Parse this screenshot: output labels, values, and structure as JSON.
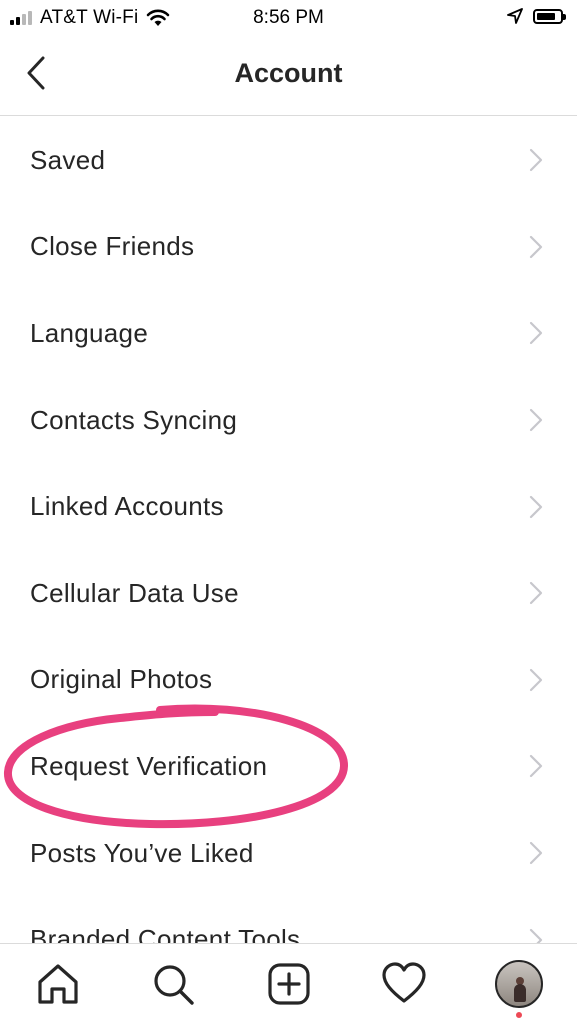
{
  "status_bar": {
    "carrier": "AT&T Wi-Fi",
    "time": "8:56 PM",
    "icons": [
      "signal-icon",
      "wifi-icon",
      "location-arrow-icon",
      "battery-icon"
    ]
  },
  "header": {
    "title": "Account",
    "back_icon": "chevron-left-icon"
  },
  "settings_list": [
    {
      "label": "Saved"
    },
    {
      "label": "Close Friends"
    },
    {
      "label": "Language"
    },
    {
      "label": "Contacts Syncing"
    },
    {
      "label": "Linked Accounts"
    },
    {
      "label": "Cellular Data Use"
    },
    {
      "label": "Original Photos"
    },
    {
      "label": "Request Verification"
    },
    {
      "label": "Posts You’ve Liked"
    },
    {
      "label": "Branded Content Tools"
    }
  ],
  "annotation": {
    "circled_item": "Request Verification",
    "color": "#e8407f"
  },
  "tab_bar": {
    "tabs": [
      "home-icon",
      "search-icon",
      "new-post-icon",
      "activity-heart-icon",
      "profile-avatar"
    ],
    "notification_dot_color": "#ed4956"
  }
}
